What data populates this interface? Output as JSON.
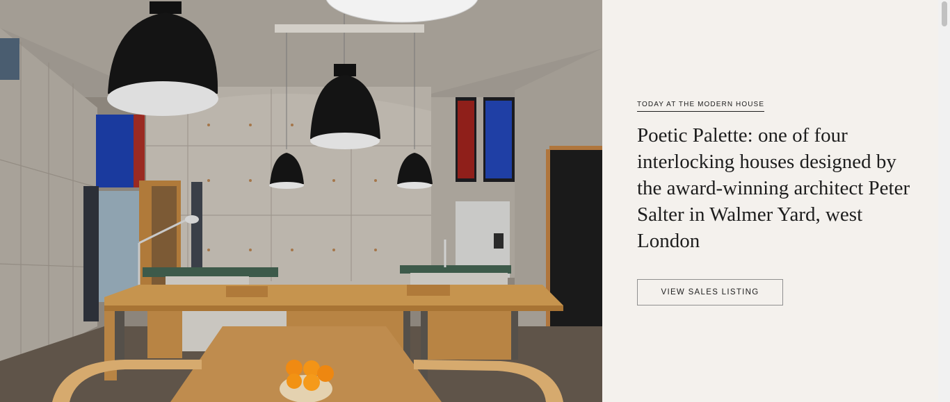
{
  "hero": {
    "image_alt": "Concrete kitchen interior with black pendant lamps, wooden island and dining table",
    "eyebrow": "TODAY AT THE MODERN HOUSE",
    "headline": "Poetic Palette: one of four interlocking houses designed by the award-winning architect Peter Salter in Walmer Yard, west London",
    "cta_label": "VIEW SALES LISTING"
  },
  "colors": {
    "panel_background": "#f4f1ed",
    "text": "#1d1d1d",
    "button_border": "#8f8f8f"
  }
}
